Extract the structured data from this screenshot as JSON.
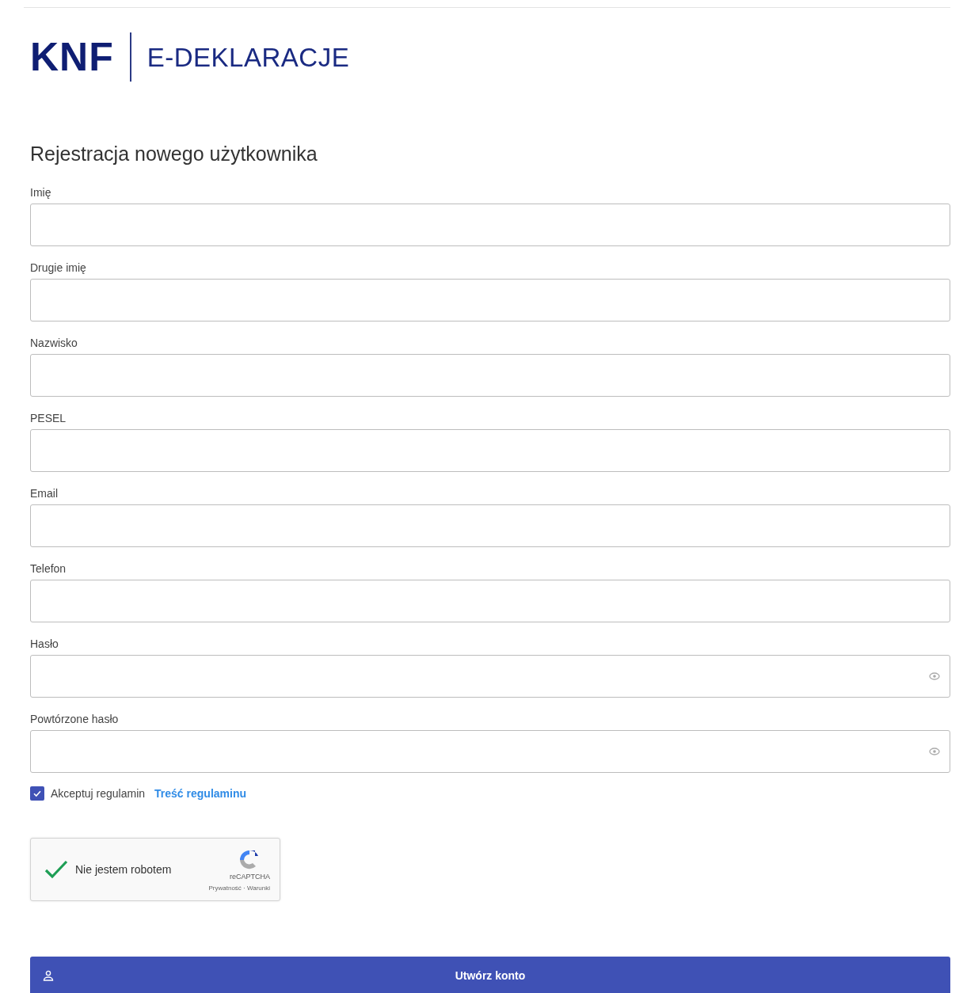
{
  "logo": {
    "mark": "KNF",
    "product": "E-DEKLARACJE"
  },
  "title": "Rejestracja nowego użytkownika",
  "fields": [
    {
      "label": "Imię",
      "kind": "text"
    },
    {
      "label": "Drugie imię",
      "kind": "text"
    },
    {
      "label": "Nazwisko",
      "kind": "text"
    },
    {
      "label": "PESEL",
      "kind": "text"
    },
    {
      "label": "Email",
      "kind": "text"
    },
    {
      "label": "Telefon",
      "kind": "text"
    },
    {
      "label": "Hasło",
      "kind": "password"
    },
    {
      "label": "Powtórzone hasło",
      "kind": "password"
    }
  ],
  "terms": {
    "label": "Akceptuj regulamin",
    "checked": true,
    "link": "Treść regulaminu"
  },
  "captcha": {
    "label": "Nie jestem robotem",
    "checked": true,
    "brand": "reCAPTCHA",
    "links": "Prywatność · Warunki"
  },
  "submit": "Utwórz konto"
}
